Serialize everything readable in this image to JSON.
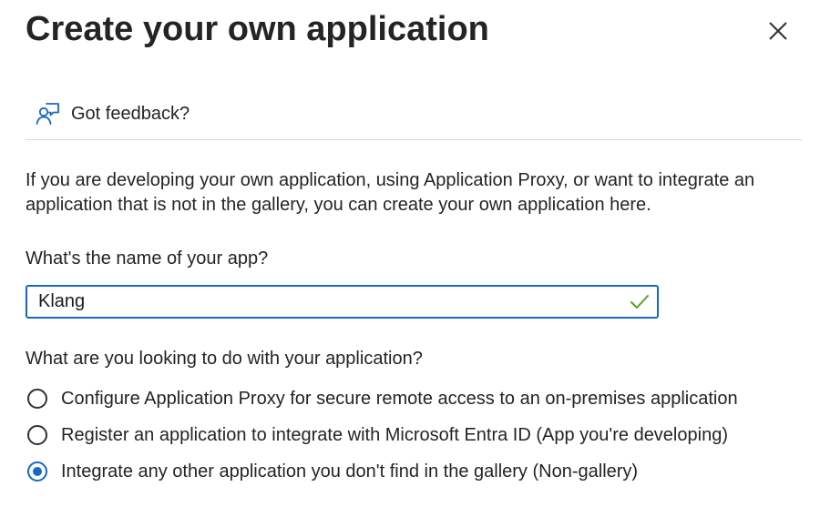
{
  "panel": {
    "title": "Create your own application",
    "close_icon": "close-icon"
  },
  "feedback": {
    "icon": "feedback-person-icon",
    "label": "Got feedback?"
  },
  "description": "If you are developing your own application, using Application Proxy, or want to integrate an application that is not in the gallery, you can create your own application here.",
  "app_name": {
    "label": "What's the name of your app?",
    "value": "Klang",
    "valid": true,
    "valid_color": "#5aa02c",
    "focus_color": "#1669c6"
  },
  "purpose": {
    "question": "What are you looking to do with your application?",
    "options": [
      {
        "label": "Configure Application Proxy for secure remote access to an on-premises application",
        "selected": false
      },
      {
        "label": "Register an application to integrate with Microsoft Entra ID (App you're developing)",
        "selected": false
      },
      {
        "label": "Integrate any other application you don't find in the gallery (Non-gallery)",
        "selected": true
      }
    ]
  }
}
